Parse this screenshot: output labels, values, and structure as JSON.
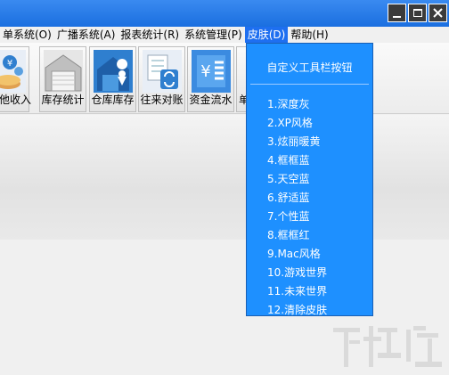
{
  "window": {
    "controls": {
      "minimize_icon": "minimize-icon",
      "maximize_icon": "maximize-icon",
      "close_icon": "close-icon"
    }
  },
  "menubar": {
    "items": [
      {
        "label": "单系统(O)"
      },
      {
        "label": "广播系统(A)"
      },
      {
        "label": "报表统计(R)"
      },
      {
        "label": "系统管理(P)"
      },
      {
        "label": "皮肤(D)",
        "active": true
      },
      {
        "label": "帮助(H)"
      }
    ]
  },
  "toolbar": {
    "items": [
      {
        "label": "他收入",
        "icon": "money-icon"
      },
      {
        "label": "库存统计",
        "icon": "warehouse-icon"
      },
      {
        "label": "仓库库存",
        "icon": "warehouse-location-icon"
      },
      {
        "label": "往来对账",
        "icon": "reconcile-icon"
      },
      {
        "label": "资金流水",
        "icon": "cash-flow-icon"
      },
      {
        "label": "单"
      }
    ]
  },
  "skin_menu": {
    "header": "自定义工具栏按钮",
    "items": [
      "1.深度灰",
      "2.XP风格",
      "3.炫丽暖黄",
      "4.框框蓝",
      "5.天空蓝",
      "6.舒适蓝",
      "7.个性蓝",
      "8.框框红",
      "9.Mac风格",
      "10.游戏世界",
      "11.未来世界",
      "12.清除皮肤"
    ]
  },
  "colors": {
    "titlebar": "#1a6fe0",
    "menu_active": "#1e6ff0",
    "dropdown_bg": "#1e90ff",
    "toolbar_icon_blue": "#2f7fcf"
  },
  "watermark": {
    "text": "下载吧",
    "logo": "watermark-logo"
  }
}
